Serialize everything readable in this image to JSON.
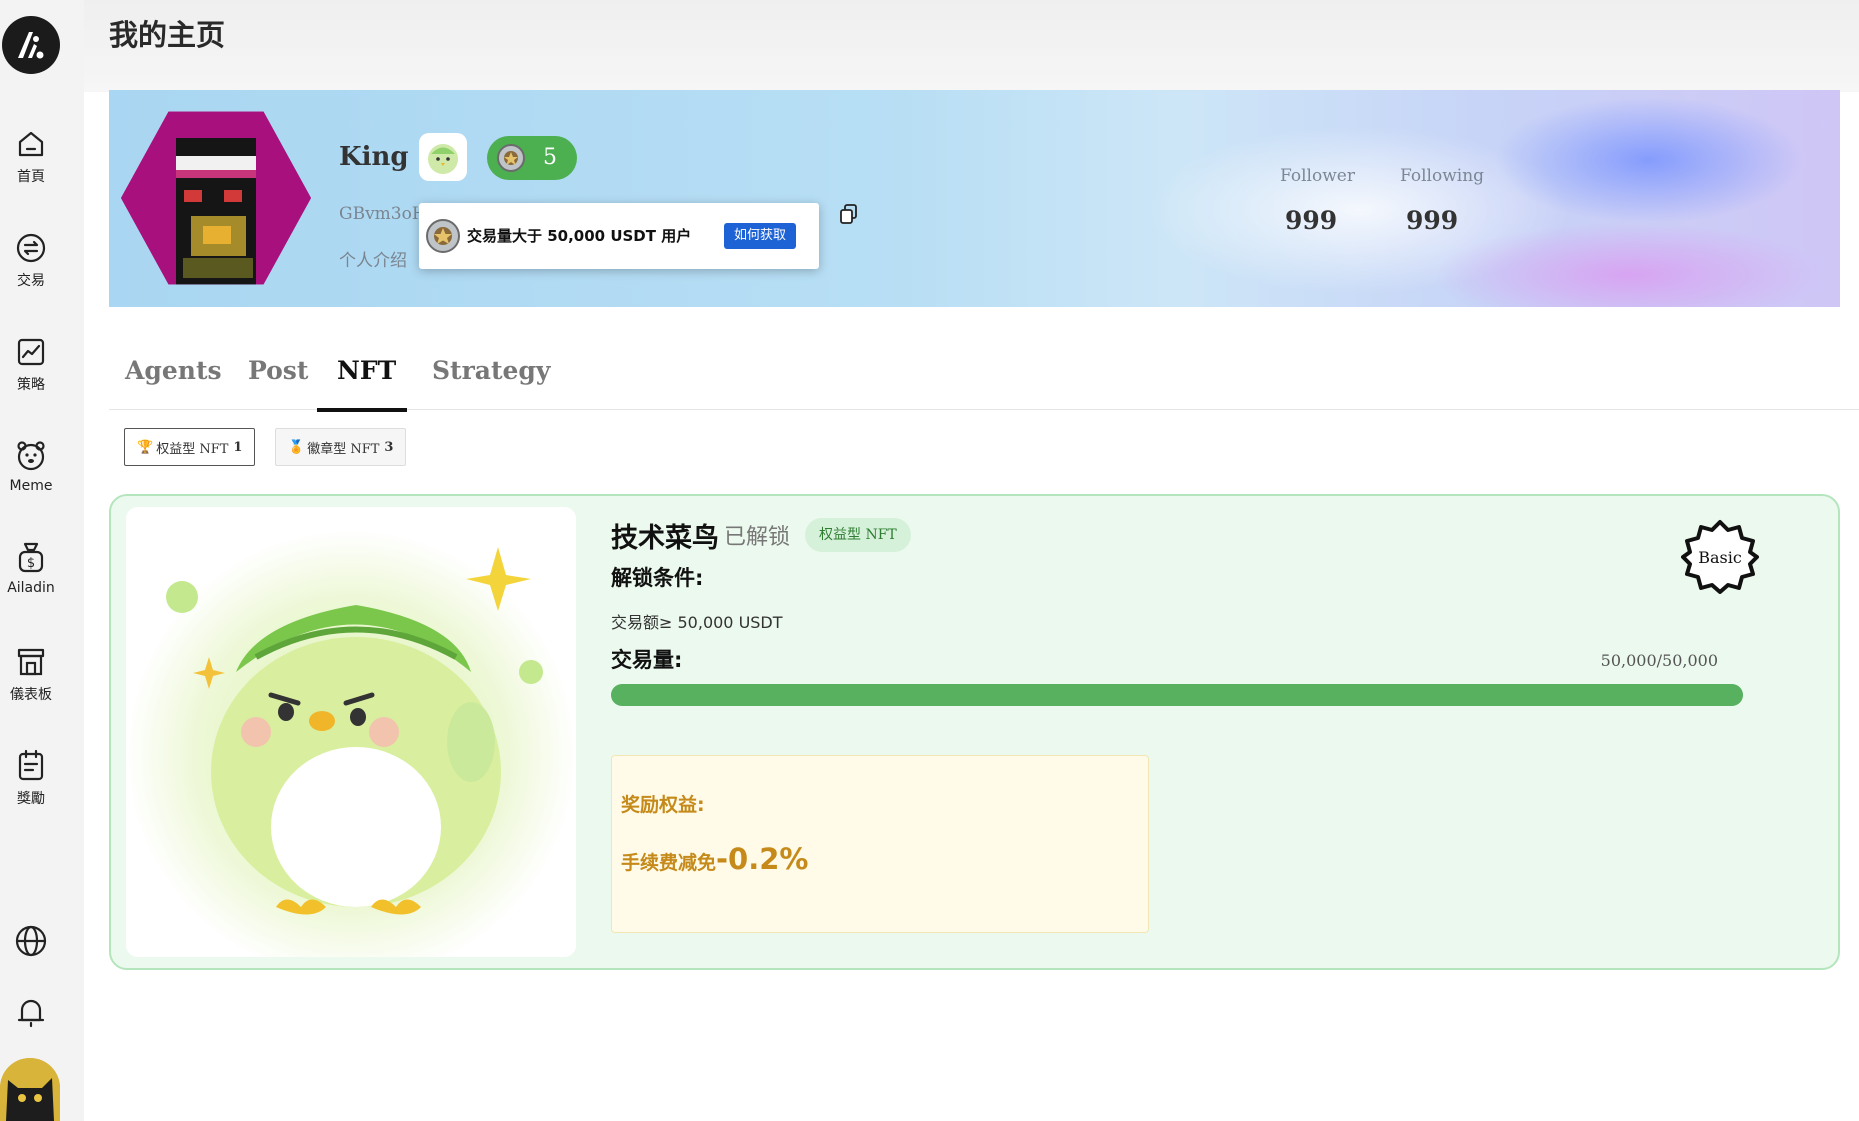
{
  "sidebar": {
    "items": [
      {
        "label": "首頁",
        "icon": "home-icon"
      },
      {
        "label": "交易",
        "icon": "exchange-icon"
      },
      {
        "label": "策略",
        "icon": "chart-icon"
      },
      {
        "label": "Meme",
        "icon": "bear-icon"
      },
      {
        "label": "Ailadin",
        "icon": "money-bag-icon"
      },
      {
        "label": "儀表板",
        "icon": "store-icon"
      },
      {
        "label": "獎勵",
        "icon": "clipboard-icon"
      }
    ],
    "extra_icons": [
      "globe-icon",
      "bell-icon"
    ]
  },
  "header": {
    "title": "我的主页"
  },
  "profile": {
    "name": "King",
    "badge_count": "5",
    "address": "GBvm3oH",
    "bio": "个人介绍",
    "follower_label": "Follower",
    "follower_value": "999",
    "following_label": "Following",
    "following_value": "999"
  },
  "tooltip": {
    "text": "交易量大于 50,000 USDT 用户",
    "button": "如何获取"
  },
  "tabs": [
    {
      "label": "Agents",
      "active": false
    },
    {
      "label": "Post",
      "active": false
    },
    {
      "label": "NFT",
      "active": true
    },
    {
      "label": "Strategy",
      "active": false
    }
  ],
  "filters": [
    {
      "icon": "🏆",
      "label": "权益型 NFT",
      "count": "1",
      "active": true
    },
    {
      "icon": "🏅",
      "label": "徽章型 NFT",
      "count": "3",
      "active": false
    }
  ],
  "nft": {
    "title": "技术菜鸟",
    "status": "已解锁",
    "tag": "权益型 NFT",
    "condition_title": "解锁条件:",
    "condition_text": "交易额≥ 50,000 USDT",
    "volume_title": "交易量:",
    "volume_text": "50,000/50,000",
    "progress": 1.0,
    "reward_label": "奖励权益:",
    "reward_prefix": "手续费减免",
    "reward_value": "-0.2%",
    "level": "Basic"
  },
  "colors": {
    "accent_green": "#57b15f",
    "reward_gold": "#c58a1a",
    "button_blue": "#1e63d6"
  }
}
